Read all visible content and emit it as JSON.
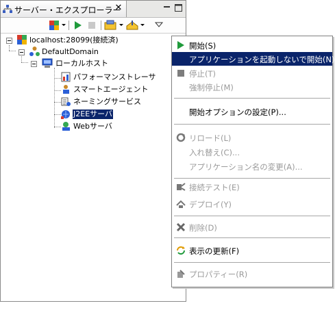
{
  "view": {
    "title": "サーバー・エクスプローラー",
    "close_glyph": "✕"
  },
  "toolbar": {
    "icons": [
      "server-icon",
      "dropdown-arrow",
      "start-icon",
      "stop-icon",
      "deploy-icon",
      "dropdown-arrow",
      "export-icon",
      "dropdown-arrow",
      "view-menu-icon"
    ]
  },
  "tree": {
    "root": "localhost:28099(接続済)",
    "domain": "DefaultDomain",
    "host": "ローカルホスト",
    "items": [
      "パフォーマンストレーサ",
      "スマートエージェント",
      "ネーミングサービス",
      "J2EEサーバ",
      "Webサーバ"
    ],
    "selected": "J2EEサーバ"
  },
  "menu": {
    "start": "開始(S)",
    "start_no_app": "アプリケーションを起動しないで開始(N)",
    "stop": "停止(T)",
    "force_stop": "強制停止(M)",
    "start_options": "開始オプションの設定(P)...",
    "reload": "リロード(L)",
    "replace": "入れ替え(C)...",
    "rename_app": "アプリケーション名の変更(A)...",
    "connection_test": "接続テスト(E)",
    "deploy": "デプロイ(Y)",
    "delete": "削除(D)",
    "refresh": "表示の更新(F)",
    "properties": "プロパティー(R)"
  },
  "colors": {
    "selection": "#0a246a",
    "disabled_text": "#9a9a9a"
  }
}
